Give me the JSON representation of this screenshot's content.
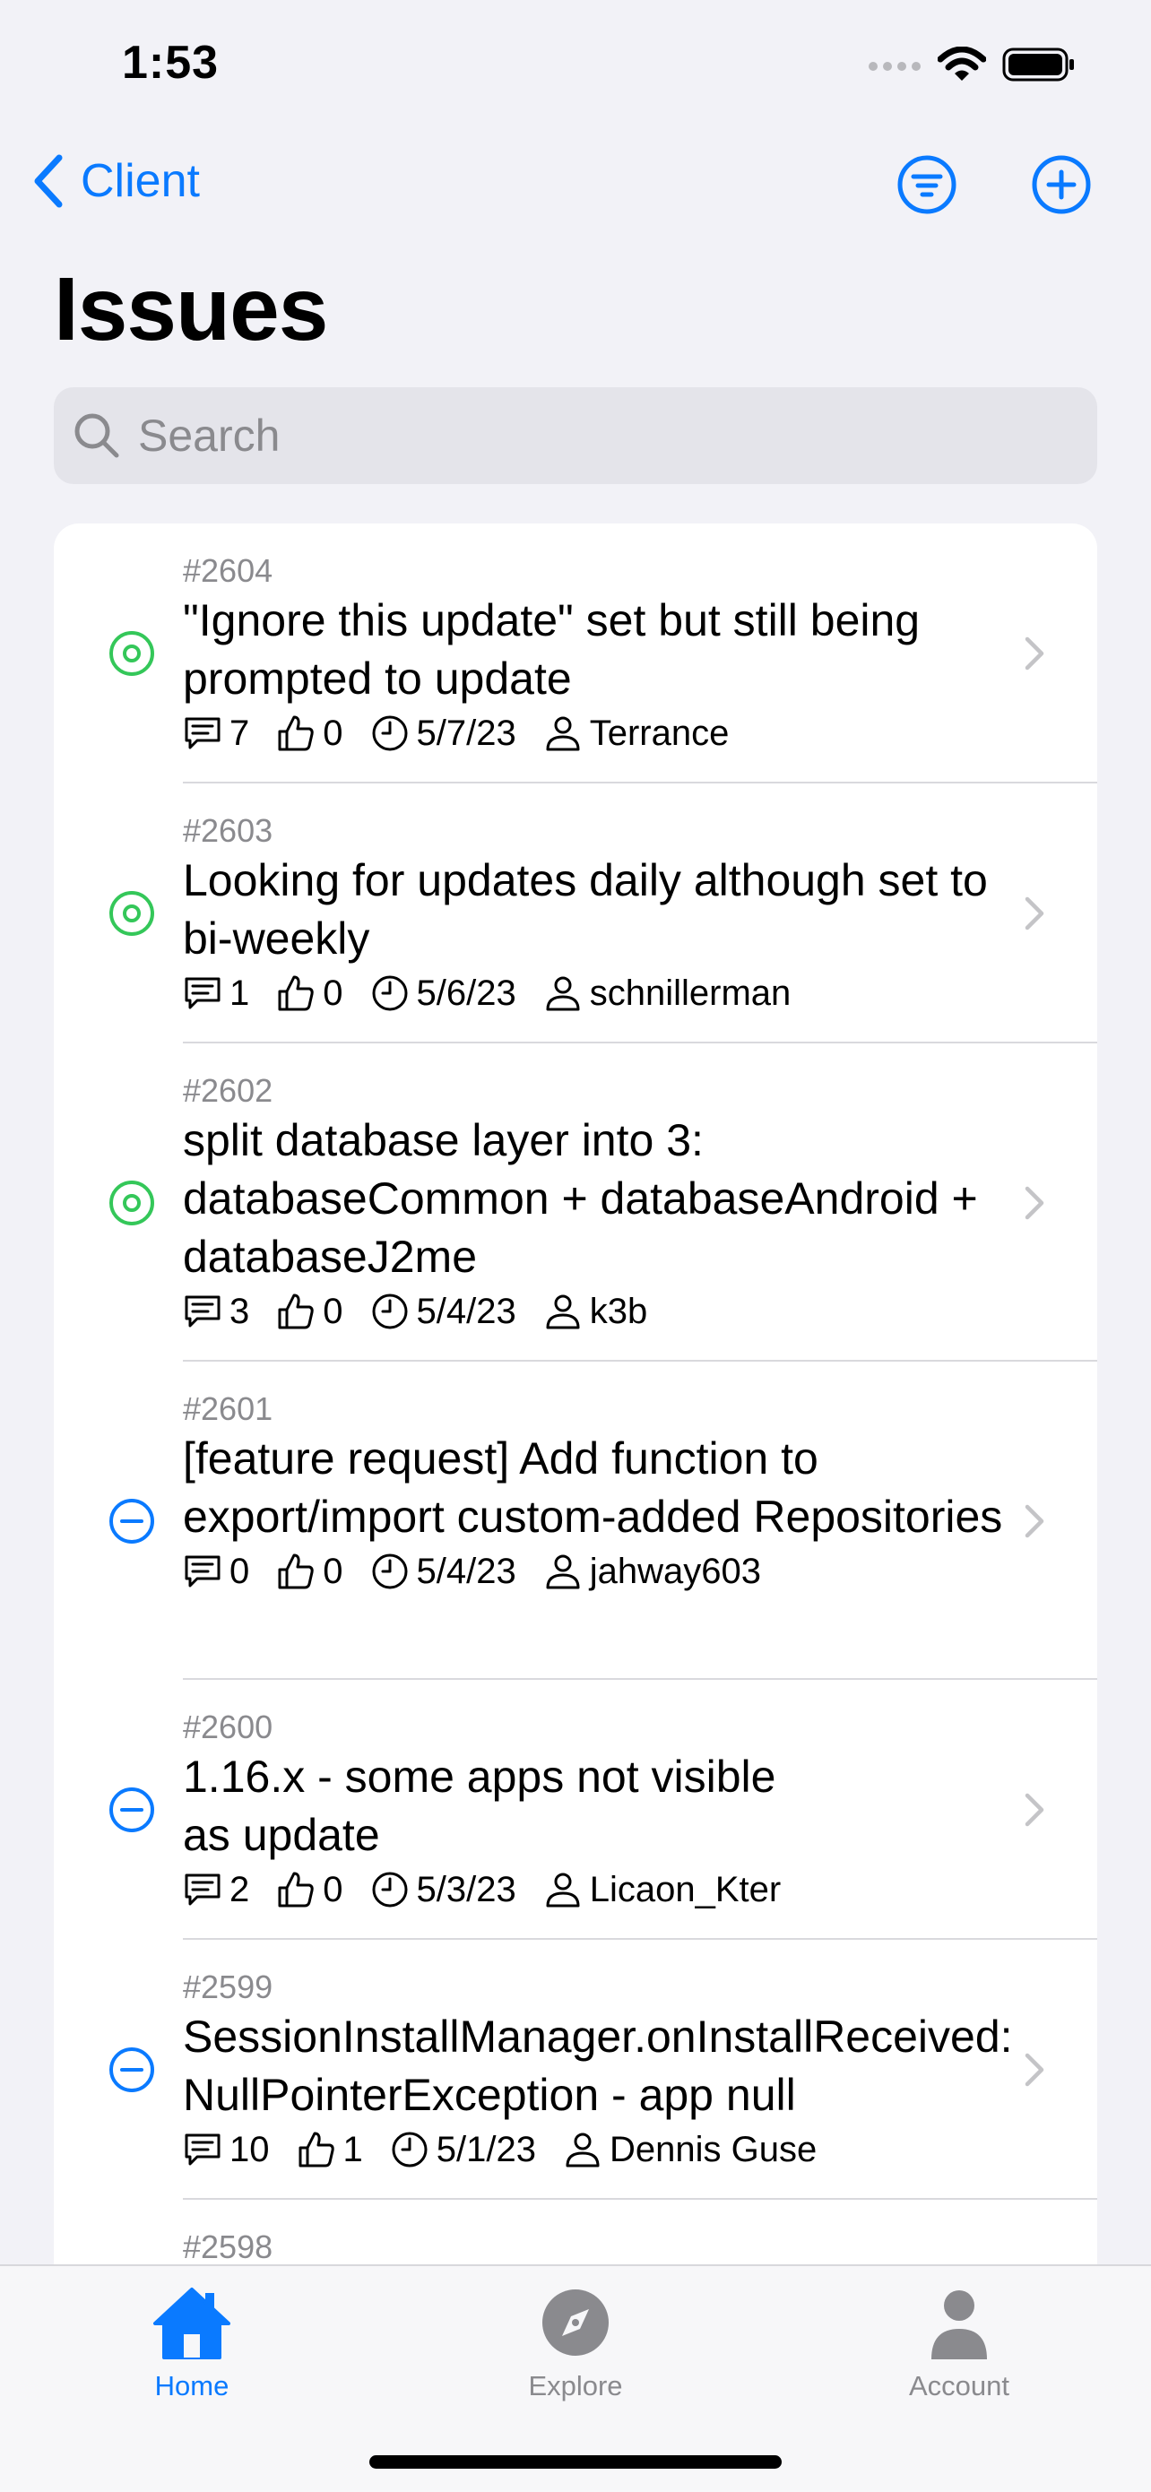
{
  "status_bar": {
    "time": "1:53",
    "icons": [
      "signal-icon",
      "wifi-icon",
      "battery-icon"
    ]
  },
  "nav": {
    "back_label": "Client",
    "back_icon": "chevron-left-icon",
    "actions": [
      "filter-icon",
      "add-circle-icon"
    ]
  },
  "title": "Issues",
  "search": {
    "placeholder": "Search",
    "value": ""
  },
  "colors": {
    "accent": "#0a7aff",
    "open_state": "#34c759",
    "closed_state": "#0a7aff",
    "inactive_tab": "#8a8a8e"
  },
  "issues": [
    {
      "number": "#2604",
      "title": "\"Ignore this update\" set but still being prompted to update",
      "state": "open",
      "comments": "7",
      "likes": "0",
      "date": "5/7/23",
      "author": "Terrance"
    },
    {
      "number": "#2603",
      "title": "Looking for updates daily although set to bi-weekly",
      "state": "open",
      "comments": "1",
      "likes": "0",
      "date": "5/6/23",
      "author": "schnillerman"
    },
    {
      "number": "#2602",
      "title": "split database layer into 3: databaseCommon + databaseAndroid + databaseJ2me",
      "state": "open",
      "comments": "3",
      "likes": "0",
      "date": "5/4/23",
      "author": "k3b"
    },
    {
      "number": "#2601",
      "title": "[feature request] Add function to export/import custom-added Repositories",
      "state": "closed",
      "comments": "0",
      "likes": "0",
      "date": "5/4/23",
      "author": "jahway603"
    },
    {
      "number": "#2600",
      "title": "1.16.x - some apps not visible as update",
      "state": "closed",
      "comments": "2",
      "likes": "0",
      "date": "5/3/23",
      "author": "Licaon_Kter"
    },
    {
      "number": "#2599",
      "title": "SessionInstallManager.onInstallReceived: NullPointerException - app null",
      "state": "closed",
      "comments": "10",
      "likes": "1",
      "date": "5/1/23",
      "author": "Dennis Guse"
    },
    {
      "number": "#2598",
      "title": "",
      "state": "open",
      "comments": "",
      "likes": "",
      "date": "",
      "author": ""
    }
  ],
  "tabs": [
    {
      "label": "Home",
      "icon": "house-icon",
      "active": true
    },
    {
      "label": "Explore",
      "icon": "compass-icon",
      "active": false
    },
    {
      "label": "Account",
      "icon": "person-icon",
      "active": false
    }
  ]
}
